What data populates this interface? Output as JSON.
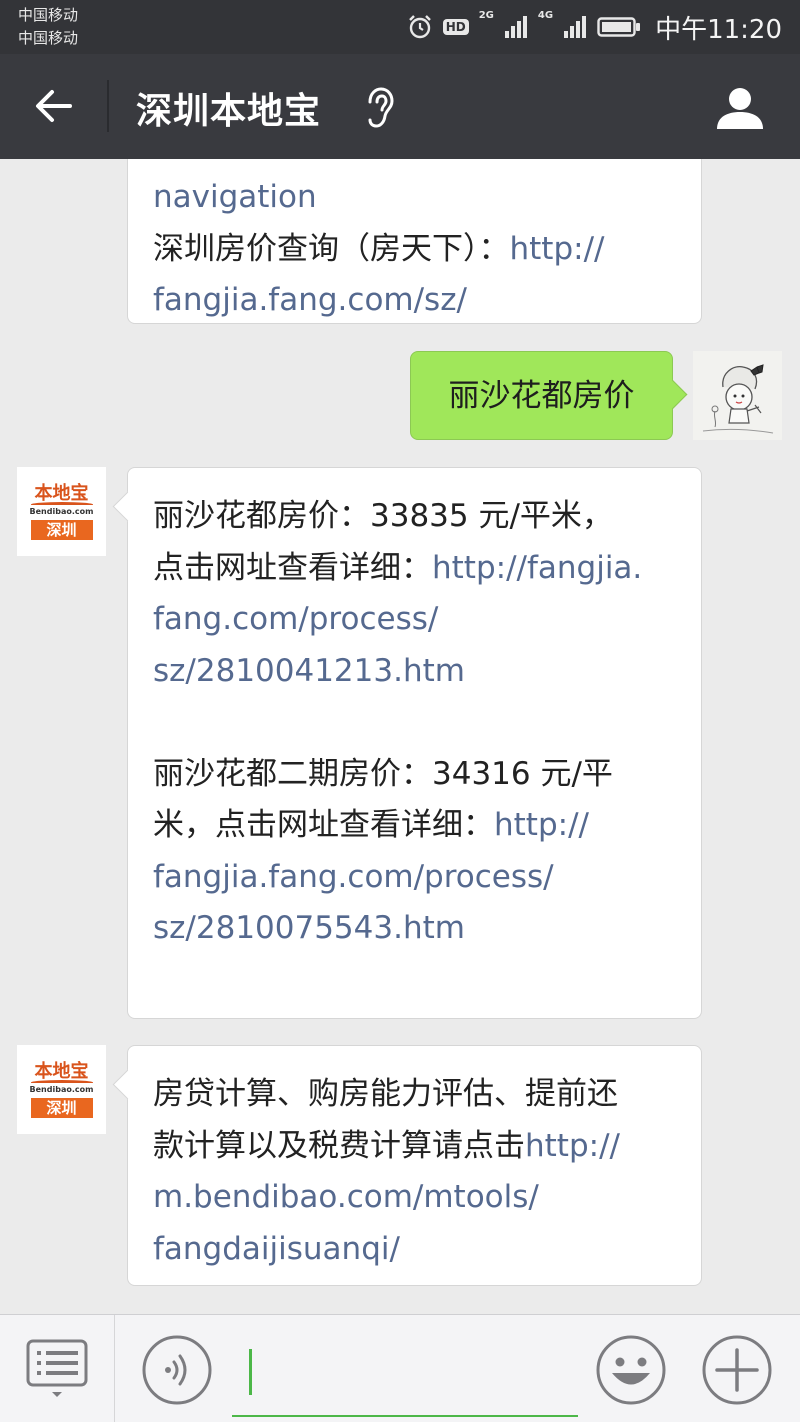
{
  "status_bar": {
    "carrier_1": "中国移动",
    "carrier_2": "中国移动",
    "hd": "HD",
    "net_1": "2G",
    "net_2": "4G",
    "time": "中午11:20",
    "icons": [
      "alarm-icon",
      "signal-icon",
      "battery-icon"
    ]
  },
  "header": {
    "title": "深圳本地宝",
    "icons": [
      "back-arrow-icon",
      "ear-icon",
      "profile-icon"
    ]
  },
  "messages": [
    {
      "from": "bot",
      "line_1_link": "navigation",
      "line_2_text": "深圳房价查询（房天下）：",
      "line_2_link": "http://",
      "line_3_link": "fangjia.fang.com/sz/"
    },
    {
      "from": "user",
      "text": "丽沙花都房价"
    },
    {
      "from": "bot",
      "sender": {
        "logo_main": "本地宝",
        "logo_site": "Bendibao.com",
        "logo_city": "深圳"
      },
      "p1_line_1": "丽沙花都房价：33835 元/平米，",
      "p1_line_2_text": "点击网址查看详细：",
      "p1_line_2_link": "http://fangjia.",
      "p1_line_3_link": "fang.com/process/",
      "p1_line_4_link": "sz/2810041213.htm",
      "p2_line_1": "丽沙花都二期房价：34316 元/平",
      "p2_line_2_text": "米，点击网址查看详细：",
      "p2_line_2_link": "http://",
      "p2_line_3_link": "fangjia.fang.com/process/",
      "p2_line_4_link": "sz/2810075543.htm"
    },
    {
      "from": "bot",
      "sender": {
        "logo_main": "本地宝",
        "logo_site": "Bendibao.com",
        "logo_city": "深圳"
      },
      "line_1": "房贷计算、购房能力评估、提前还",
      "line_2_text": "款计算以及税费计算请点击",
      "line_2_link": "http://",
      "line_3_link": "m.bendibao.com/mtools/",
      "line_4_link": "fangdaijisuanqi/"
    }
  ],
  "input_bar": {
    "input_value": "",
    "icons": [
      "menu-list-icon",
      "voice-icon",
      "emoji-icon",
      "plus-icon"
    ]
  },
  "colors": {
    "link": "#55698f",
    "sent_bubble": "#a0e75a",
    "header_bg": "#393a3f",
    "chat_bg": "#ebebeb",
    "input_accent": "#4cb748"
  }
}
